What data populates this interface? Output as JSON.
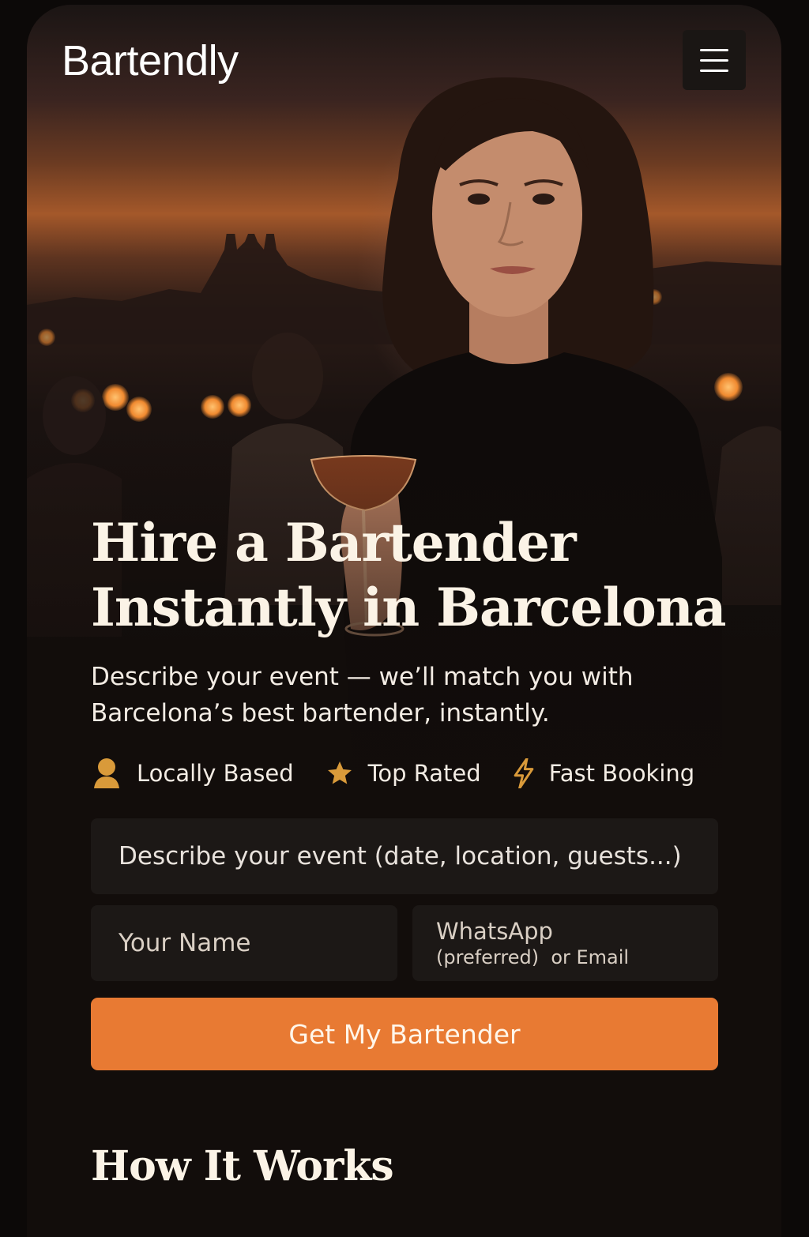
{
  "header": {
    "brand": "Bartendly",
    "menu_icon": "hamburger-menu-icon"
  },
  "hero": {
    "headline_line1": "Hire a Bartender",
    "headline_line2": "Instantly in Barcelona",
    "subhead_line1": "Describe your event — we’ll match you with",
    "subhead_line2": "Barcelona’s best bartender, instantly.",
    "image": "bartender-with-cocktail-photo"
  },
  "features": [
    {
      "label": "Locally Based",
      "icon": "person-icon"
    },
    {
      "label": "Top Rated",
      "icon": "star-icon"
    },
    {
      "label": "Fast Booking",
      "icon": "lightning-bolt-icon"
    }
  ],
  "form": {
    "event_placeholder": "Describe your event (date, location, guests...)",
    "name_placeholder": "Your Name",
    "contact_placeholder_line1": "WhatsApp",
    "contact_placeholder_line2": "(preferred)  or Email",
    "submit_label": "Get My Bartender"
  },
  "how_it_works": {
    "title": "How It Works"
  },
  "colors": {
    "accent": "#e87a33",
    "icon_gold": "#d99a3a",
    "background": "#120d0b",
    "input_bg": "#1c1816",
    "text_light": "#fbf3e6"
  }
}
